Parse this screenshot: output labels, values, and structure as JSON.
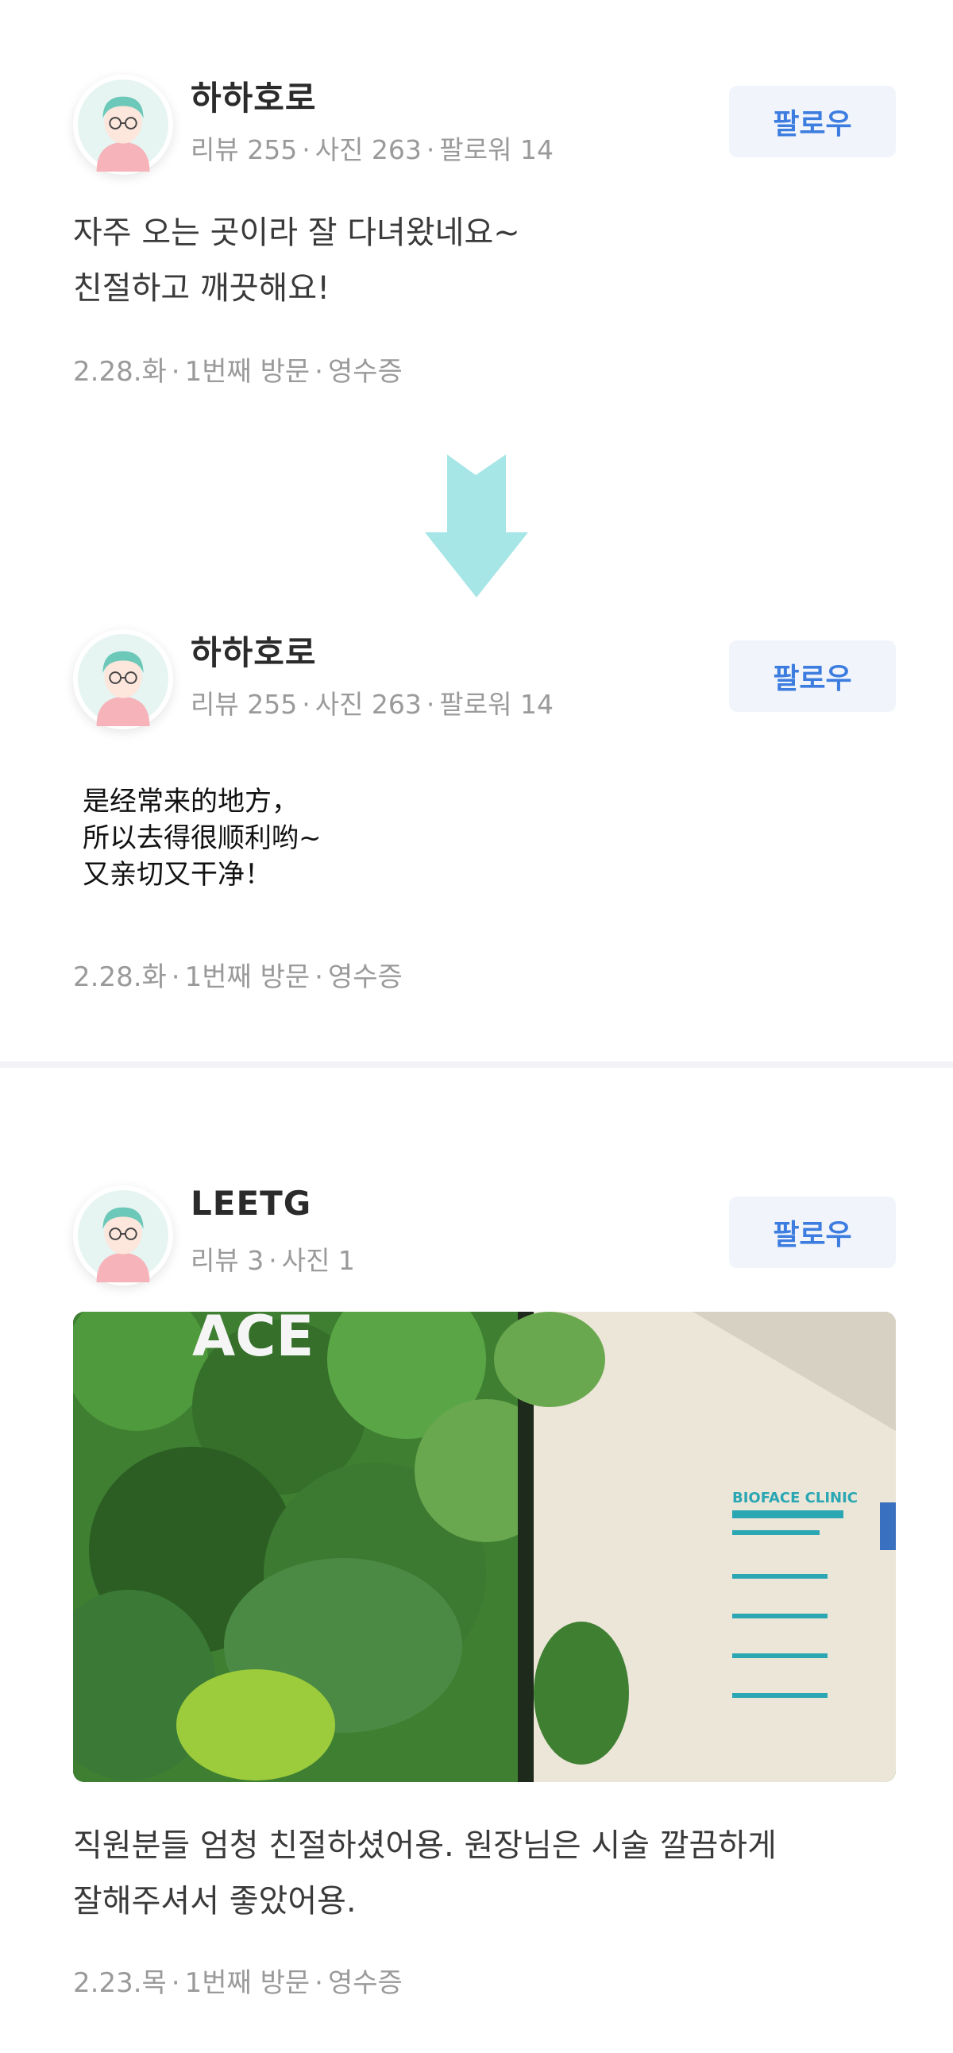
{
  "reviews": [
    {
      "nickname": "하하호로",
      "stats": [
        "리뷰 255",
        "사진 263",
        "팔로워 14"
      ],
      "follow_label": "팔로우",
      "text_lines": [
        "자주 오는 곳이라 잘 다녀왔네요~",
        "친절하고 깨끗해요!"
      ],
      "meta": [
        "2.28.화",
        "1번째 방문",
        "영수증"
      ]
    },
    {
      "nickname": "하하호로",
      "stats": [
        "리뷰 255",
        "사진 263",
        "팔로워 14"
      ],
      "follow_label": "팔로우",
      "text_lines": [
        "是经常来的地方，",
        "所以去得很顺利哟~",
        "又亲切又干净！"
      ],
      "meta": [
        "2.28.화",
        "1번째 방문",
        "영수증"
      ]
    },
    {
      "nickname": "LEETG",
      "stats": [
        "리뷰 3",
        "사진 1"
      ],
      "follow_label": "팔로우",
      "text_lines": [
        "직원분들 엄청 친절하셨어용. 원장님은 시술 깔끔하게",
        "잘해주셔서 좋았어용."
      ],
      "meta": [
        "2.23.목",
        "1번째 방문",
        "영수증"
      ]
    }
  ],
  "photo_sign_text": "BIOFACE CLINIC",
  "photo_wall_text": "ACE",
  "colors": {
    "follow_text": "#3d7de0",
    "follow_bg": "#f1f5fb",
    "arrow": "#a6e6e6"
  },
  "icons": {
    "arrow": "down-arrow-icon",
    "avatar": "avatar-icon"
  }
}
